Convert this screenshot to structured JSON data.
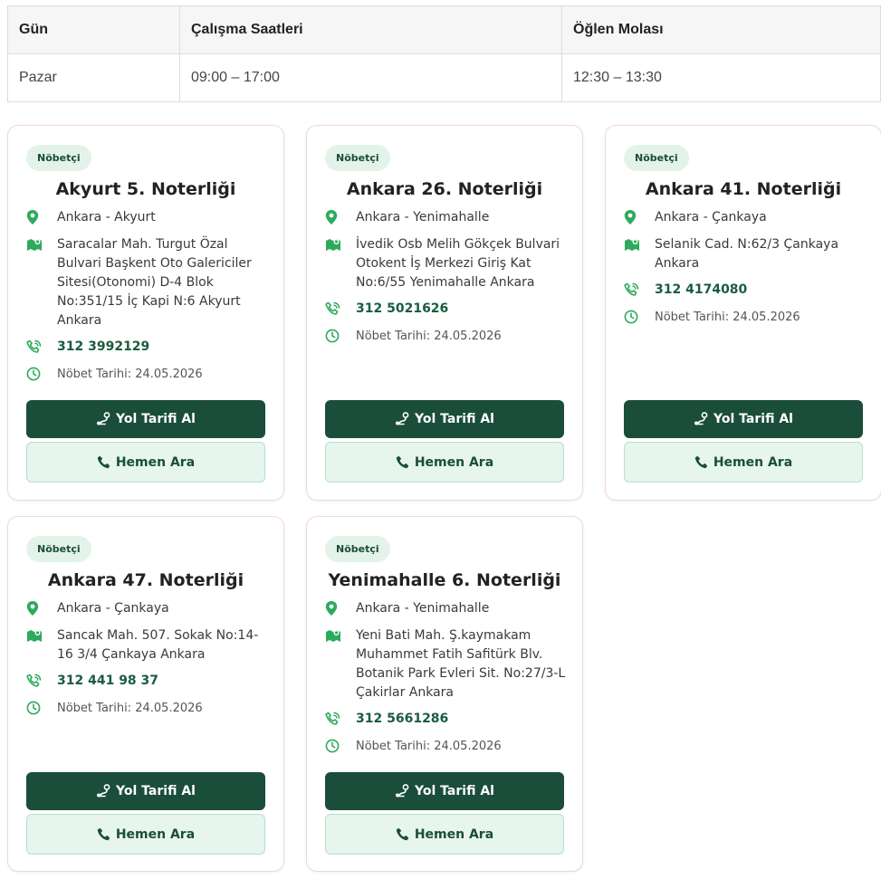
{
  "table": {
    "headers": [
      "Gün",
      "Çalışma Saatleri",
      "Öğlen Molası"
    ],
    "rows": [
      [
        "Pazar",
        "09:00 – 17:00",
        "12:30 – 13:30"
      ]
    ]
  },
  "colors": {
    "primary": "#1a4d3a",
    "icon_green": "#2eaa5c",
    "badge_bg": "#e3f3ea",
    "call_bg": "#e6f5ee"
  },
  "cards": [
    {
      "badge": "Nöbetçi",
      "title": "Akyurt 5. Noterliği",
      "location": "Ankara - Akyurt",
      "address": "Saracalar Mah. Turgut Özal Bulvari Başkent Oto Galericiler Sitesi(Otonomi) D-4 Blok No:351/15 İç Kapi N:6 Akyurt Ankara",
      "phone": "312 3992129",
      "duty_date": "Nöbet Tarihi: 24.05.2026",
      "directions_label": "Yol Tarifi Al",
      "call_label": "Hemen Ara"
    },
    {
      "badge": "Nöbetçi",
      "title": "Ankara 26. Noterliği",
      "location": "Ankara - Yenimahalle",
      "address": "İvedik Osb Melih Gökçek Bulvari Otokent İş Merkezi Giriş Kat No:6/55 Yenimahalle Ankara",
      "phone": "312 5021626",
      "duty_date": "Nöbet Tarihi: 24.05.2026",
      "directions_label": "Yol Tarifi Al",
      "call_label": "Hemen Ara"
    },
    {
      "badge": "Nöbetçi",
      "title": "Ankara 41. Noterliği",
      "location": "Ankara - Çankaya",
      "address": "Selanik Cad. N:62/3 Çankaya Ankara",
      "phone": "312 4174080",
      "duty_date": "Nöbet Tarihi: 24.05.2026",
      "directions_label": "Yol Tarifi Al",
      "call_label": "Hemen Ara"
    },
    {
      "badge": "Nöbetçi",
      "title": "Ankara 47. Noterliği",
      "location": "Ankara - Çankaya",
      "address": "Sancak Mah. 507. Sokak No:14-16 3/4 Çankaya Ankara",
      "phone": "312 441 98 37",
      "duty_date": "Nöbet Tarihi: 24.05.2026",
      "directions_label": "Yol Tarifi Al",
      "call_label": "Hemen Ara"
    },
    {
      "badge": "Nöbetçi",
      "title": "Yenimahalle 6. Noterliği",
      "location": "Ankara - Yenimahalle",
      "address": "Yeni Bati Mah. Ş.kaymakam Muhammet Fatih Safitürk Blv. Botanik Park Evleri Sit. No:27/3-L Çakirlar Ankara",
      "phone": "312 5661286",
      "duty_date": "Nöbet Tarihi: 24.05.2026",
      "directions_label": "Yol Tarifi Al",
      "call_label": "Hemen Ara"
    }
  ]
}
